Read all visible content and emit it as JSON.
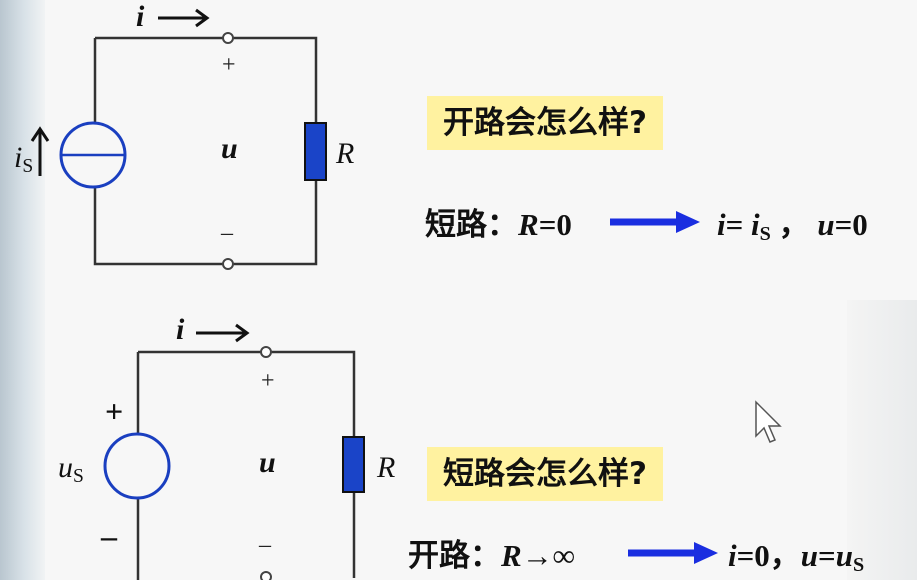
{
  "top_circuit": {
    "current_label": "i",
    "source_label": "i",
    "source_label_sub": "S",
    "voltage_label": "u",
    "resistor_label": "R",
    "plus": "+",
    "minus": "–"
  },
  "bottom_circuit": {
    "current_label": "i",
    "source_label": "u",
    "source_label_sub": "S",
    "voltage_label": "u",
    "resistor_label": "R",
    "plus": "+",
    "minus": "–",
    "source_plus": "+",
    "source_minus": "–"
  },
  "question_open": "开路会怎么样?",
  "short_line": {
    "label": "短路：",
    "condition_var": "R",
    "condition_rest": "=0",
    "result_i": "i",
    "result_eq": "= ",
    "result_is": "i",
    "result_is_sub": "S",
    "sep": " ， ",
    "result_u": "u",
    "result_u_rest": "=0"
  },
  "question_short": "短路会怎么样?",
  "open_line": {
    "label": "开路：",
    "condition_var": "R",
    "condition_rest": "→∞",
    "result_i": "i",
    "result_i_rest": "=0，",
    "result_u": "u",
    "result_eq": "=",
    "result_us": "u",
    "result_us_sub": "S"
  },
  "colors": {
    "resistor": "#1a44c8",
    "source": "#1a3fc0",
    "arrow": "#1a2ee0",
    "highlight": "#fff2a0"
  }
}
